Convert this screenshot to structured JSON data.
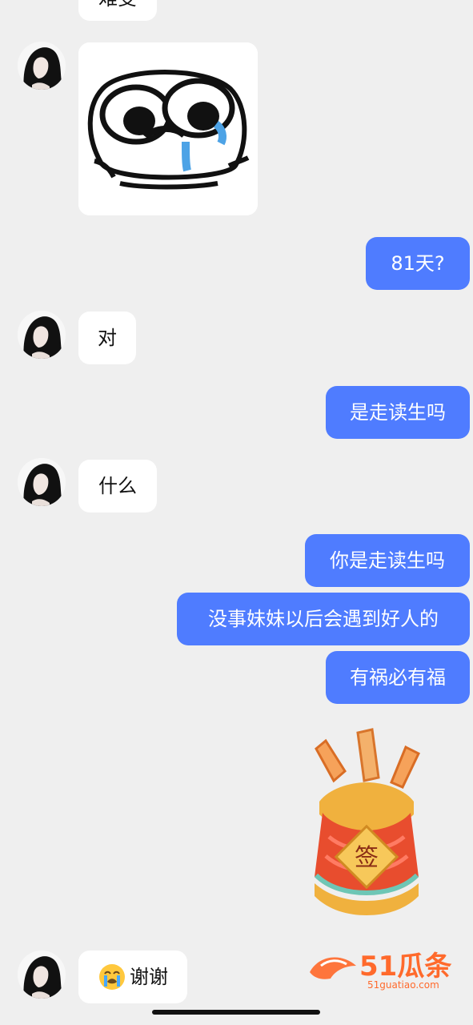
{
  "messages": [
    {
      "side": "incoming",
      "text": "难受"
    },
    {
      "side": "incoming",
      "type": "sticker",
      "icon": "crying-face-sticker"
    },
    {
      "side": "outgoing",
      "text": "81天?"
    },
    {
      "side": "incoming",
      "text": "对"
    },
    {
      "side": "outgoing",
      "text": "是走读生吗"
    },
    {
      "side": "incoming",
      "text": "什么"
    },
    {
      "side": "outgoing",
      "text": "你是走读生吗"
    },
    {
      "side": "outgoing",
      "text": "没事妹妹以后会遇到好人的"
    },
    {
      "side": "outgoing",
      "text": "有祸必有福"
    },
    {
      "side": "outgoing",
      "type": "sticker",
      "icon": "fortune-stick-cup",
      "label": "签"
    },
    {
      "side": "incoming",
      "emoji": "loudly-crying-face",
      "text": "谢谢"
    }
  ],
  "watermark": {
    "brand": "51瓜条",
    "url": "51guatiao.com"
  },
  "colors": {
    "outgoing_bubble": "#4f7cff",
    "incoming_bubble": "#ffffff",
    "background": "#efefef"
  }
}
